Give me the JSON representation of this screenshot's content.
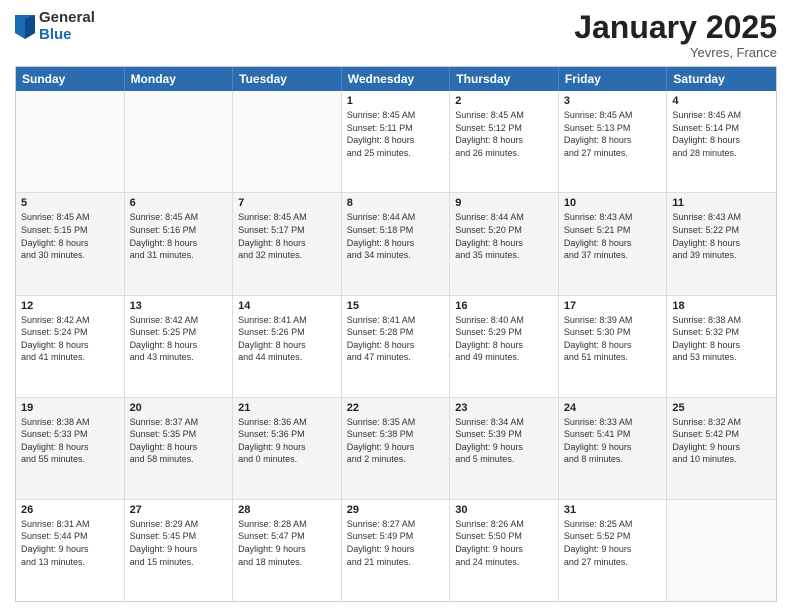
{
  "logo": {
    "general": "General",
    "blue": "Blue"
  },
  "title": "January 2025",
  "location": "Yevres, France",
  "header_days": [
    "Sunday",
    "Monday",
    "Tuesday",
    "Wednesday",
    "Thursday",
    "Friday",
    "Saturday"
  ],
  "rows": [
    [
      {
        "day": "",
        "info": ""
      },
      {
        "day": "",
        "info": ""
      },
      {
        "day": "",
        "info": ""
      },
      {
        "day": "1",
        "info": "Sunrise: 8:45 AM\nSunset: 5:11 PM\nDaylight: 8 hours\nand 25 minutes."
      },
      {
        "day": "2",
        "info": "Sunrise: 8:45 AM\nSunset: 5:12 PM\nDaylight: 8 hours\nand 26 minutes."
      },
      {
        "day": "3",
        "info": "Sunrise: 8:45 AM\nSunset: 5:13 PM\nDaylight: 8 hours\nand 27 minutes."
      },
      {
        "day": "4",
        "info": "Sunrise: 8:45 AM\nSunset: 5:14 PM\nDaylight: 8 hours\nand 28 minutes."
      }
    ],
    [
      {
        "day": "5",
        "info": "Sunrise: 8:45 AM\nSunset: 5:15 PM\nDaylight: 8 hours\nand 30 minutes."
      },
      {
        "day": "6",
        "info": "Sunrise: 8:45 AM\nSunset: 5:16 PM\nDaylight: 8 hours\nand 31 minutes."
      },
      {
        "day": "7",
        "info": "Sunrise: 8:45 AM\nSunset: 5:17 PM\nDaylight: 8 hours\nand 32 minutes."
      },
      {
        "day": "8",
        "info": "Sunrise: 8:44 AM\nSunset: 5:18 PM\nDaylight: 8 hours\nand 34 minutes."
      },
      {
        "day": "9",
        "info": "Sunrise: 8:44 AM\nSunset: 5:20 PM\nDaylight: 8 hours\nand 35 minutes."
      },
      {
        "day": "10",
        "info": "Sunrise: 8:43 AM\nSunset: 5:21 PM\nDaylight: 8 hours\nand 37 minutes."
      },
      {
        "day": "11",
        "info": "Sunrise: 8:43 AM\nSunset: 5:22 PM\nDaylight: 8 hours\nand 39 minutes."
      }
    ],
    [
      {
        "day": "12",
        "info": "Sunrise: 8:42 AM\nSunset: 5:24 PM\nDaylight: 8 hours\nand 41 minutes."
      },
      {
        "day": "13",
        "info": "Sunrise: 8:42 AM\nSunset: 5:25 PM\nDaylight: 8 hours\nand 43 minutes."
      },
      {
        "day": "14",
        "info": "Sunrise: 8:41 AM\nSunset: 5:26 PM\nDaylight: 8 hours\nand 44 minutes."
      },
      {
        "day": "15",
        "info": "Sunrise: 8:41 AM\nSunset: 5:28 PM\nDaylight: 8 hours\nand 47 minutes."
      },
      {
        "day": "16",
        "info": "Sunrise: 8:40 AM\nSunset: 5:29 PM\nDaylight: 8 hours\nand 49 minutes."
      },
      {
        "day": "17",
        "info": "Sunrise: 8:39 AM\nSunset: 5:30 PM\nDaylight: 8 hours\nand 51 minutes."
      },
      {
        "day": "18",
        "info": "Sunrise: 8:38 AM\nSunset: 5:32 PM\nDaylight: 8 hours\nand 53 minutes."
      }
    ],
    [
      {
        "day": "19",
        "info": "Sunrise: 8:38 AM\nSunset: 5:33 PM\nDaylight: 8 hours\nand 55 minutes."
      },
      {
        "day": "20",
        "info": "Sunrise: 8:37 AM\nSunset: 5:35 PM\nDaylight: 8 hours\nand 58 minutes."
      },
      {
        "day": "21",
        "info": "Sunrise: 8:36 AM\nSunset: 5:36 PM\nDaylight: 9 hours\nand 0 minutes."
      },
      {
        "day": "22",
        "info": "Sunrise: 8:35 AM\nSunset: 5:38 PM\nDaylight: 9 hours\nand 2 minutes."
      },
      {
        "day": "23",
        "info": "Sunrise: 8:34 AM\nSunset: 5:39 PM\nDaylight: 9 hours\nand 5 minutes."
      },
      {
        "day": "24",
        "info": "Sunrise: 8:33 AM\nSunset: 5:41 PM\nDaylight: 9 hours\nand 8 minutes."
      },
      {
        "day": "25",
        "info": "Sunrise: 8:32 AM\nSunset: 5:42 PM\nDaylight: 9 hours\nand 10 minutes."
      }
    ],
    [
      {
        "day": "26",
        "info": "Sunrise: 8:31 AM\nSunset: 5:44 PM\nDaylight: 9 hours\nand 13 minutes."
      },
      {
        "day": "27",
        "info": "Sunrise: 8:29 AM\nSunset: 5:45 PM\nDaylight: 9 hours\nand 15 minutes."
      },
      {
        "day": "28",
        "info": "Sunrise: 8:28 AM\nSunset: 5:47 PM\nDaylight: 9 hours\nand 18 minutes."
      },
      {
        "day": "29",
        "info": "Sunrise: 8:27 AM\nSunset: 5:49 PM\nDaylight: 9 hours\nand 21 minutes."
      },
      {
        "day": "30",
        "info": "Sunrise: 8:26 AM\nSunset: 5:50 PM\nDaylight: 9 hours\nand 24 minutes."
      },
      {
        "day": "31",
        "info": "Sunrise: 8:25 AM\nSunset: 5:52 PM\nDaylight: 9 hours\nand 27 minutes."
      },
      {
        "day": "",
        "info": ""
      }
    ]
  ]
}
